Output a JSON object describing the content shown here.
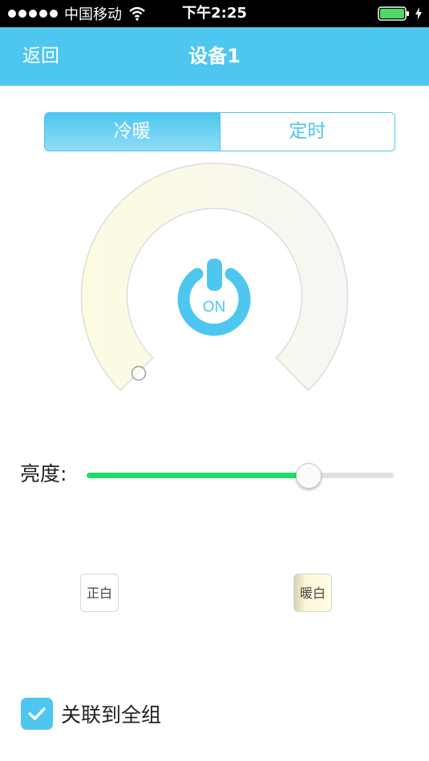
{
  "status_bar": {
    "carrier": "中国移动",
    "time": "下午2:25"
  },
  "nav": {
    "back_label": "返回",
    "title": "设备1"
  },
  "tabs": [
    {
      "label": "冷暖",
      "active": true
    },
    {
      "label": "定时",
      "active": false
    }
  ],
  "dial": {
    "power_label": "ON",
    "icon": "power-icon"
  },
  "brightness": {
    "label": "亮度:",
    "value_fraction": 0.72
  },
  "presets": {
    "normal_label": "正白",
    "warm_label": "暖白"
  },
  "link_all": {
    "label": "关联到全组",
    "checked": true
  },
  "colors": {
    "accent": "#4dc7ef",
    "slider_fill": "#1fdc6a",
    "warm_tint": "#fffbe6"
  }
}
